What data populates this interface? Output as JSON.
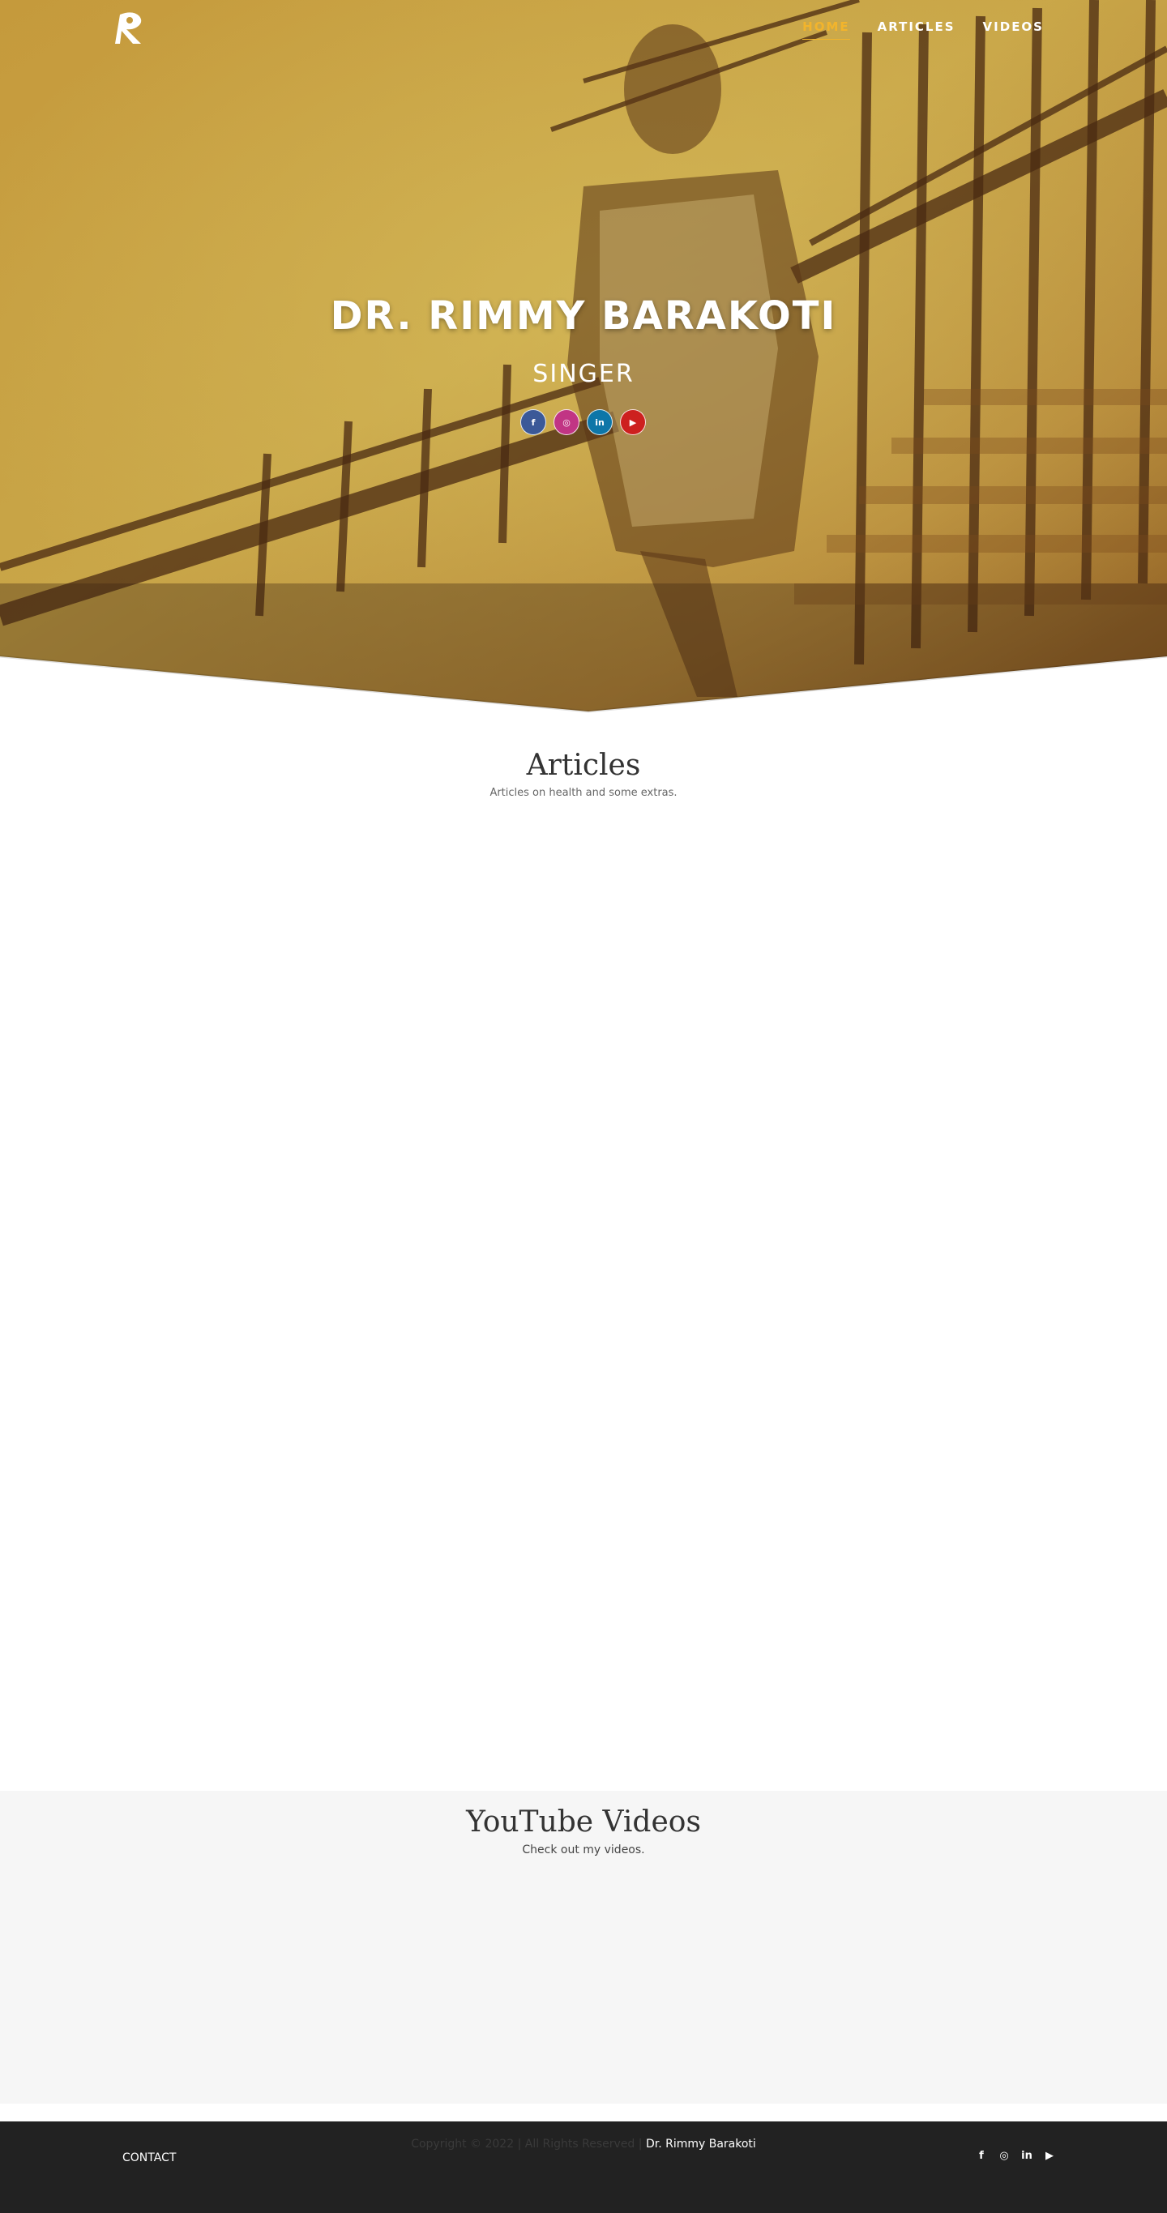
{
  "nav": {
    "logo_alt": "R",
    "links": [
      {
        "label": "HOME",
        "active": true
      },
      {
        "label": "ARTICLES",
        "active": false
      },
      {
        "label": "VIDEOS",
        "active": false
      }
    ]
  },
  "hero": {
    "name": "DR. RIMMY BARAKOTI",
    "role": "SINGER",
    "social": [
      {
        "icon": "facebook-icon",
        "glyph": "f",
        "color": "#3b5998"
      },
      {
        "icon": "instagram-icon",
        "glyph": "◎",
        "color": "#c13584"
      },
      {
        "icon": "linkedin-icon",
        "glyph": "in",
        "color": "#0e76a8"
      },
      {
        "icon": "youtube-icon",
        "glyph": "▶",
        "color": "#cd201f"
      }
    ]
  },
  "articles": {
    "title": "Articles",
    "subtitle": "Articles on health and some extras."
  },
  "videos": {
    "title": "YouTube Videos",
    "subtitle": "Check out my videos."
  },
  "footer": {
    "contact": "CONTACT",
    "copyright_prefix": "Copyright © 2022 | All Rights Reserved |",
    "copyright_name": "Dr. Rimmy Barakoti",
    "social": [
      {
        "icon": "facebook-icon",
        "glyph": "f"
      },
      {
        "icon": "instagram-icon",
        "glyph": "◎"
      },
      {
        "icon": "linkedin-icon",
        "glyph": "in"
      },
      {
        "icon": "youtube-icon",
        "glyph": "▶"
      }
    ]
  },
  "colors": {
    "accent": "#f2b42c",
    "footer_bg": "#222222",
    "videos_bg": "#f6f6f6"
  }
}
